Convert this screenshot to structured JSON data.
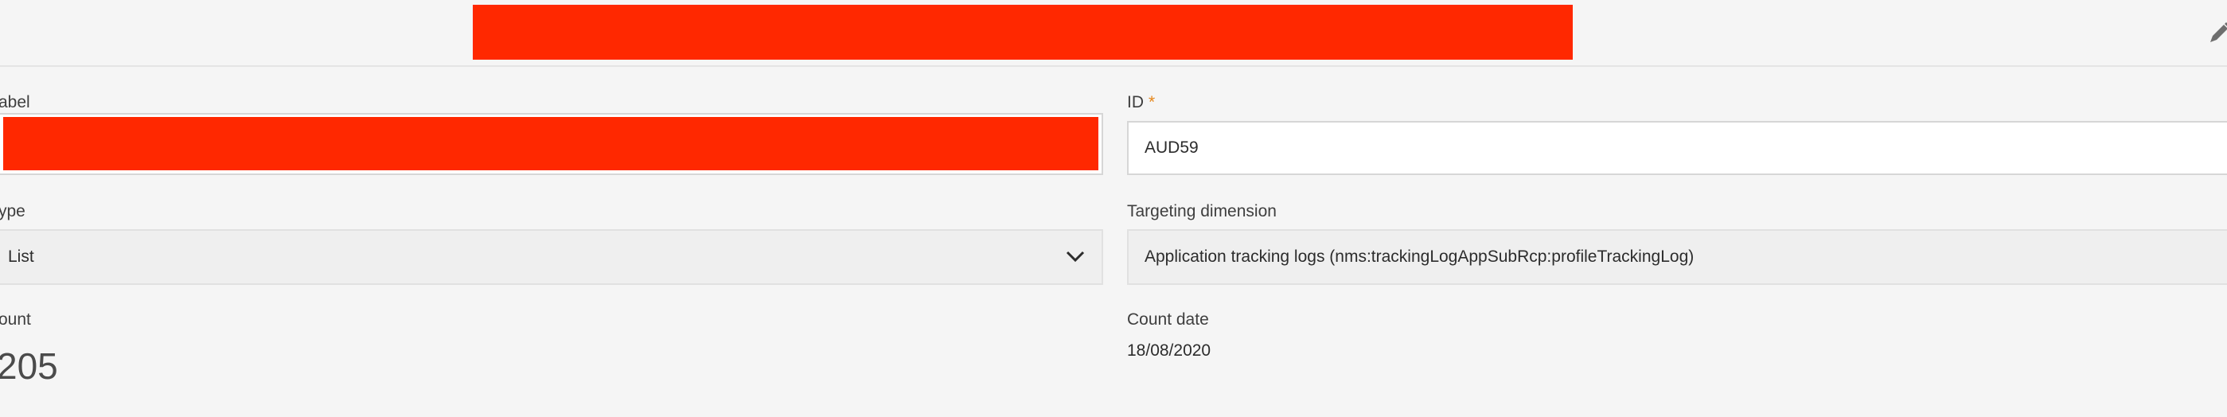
{
  "form": {
    "label_field": {
      "label": "abel"
    },
    "id_field": {
      "label": "ID",
      "required_marker": "*",
      "value": "AUD59"
    },
    "type_field": {
      "label": "ype",
      "value": "List"
    },
    "targeting_dimension": {
      "label": "Targeting dimension",
      "value": "Application tracking logs (nms:trackingLogAppSubRcp:profileTrackingLog)"
    },
    "count": {
      "label": "ount",
      "value": "205"
    },
    "count_date": {
      "label": "Count date",
      "value": "18/08/2020"
    }
  },
  "icons": {
    "edit": "pencil-icon",
    "type_dropdown": "chevron-down-icon"
  },
  "colors": {
    "redaction": "#ff2800",
    "required": "#e68619",
    "background": "#f5f5f5"
  }
}
